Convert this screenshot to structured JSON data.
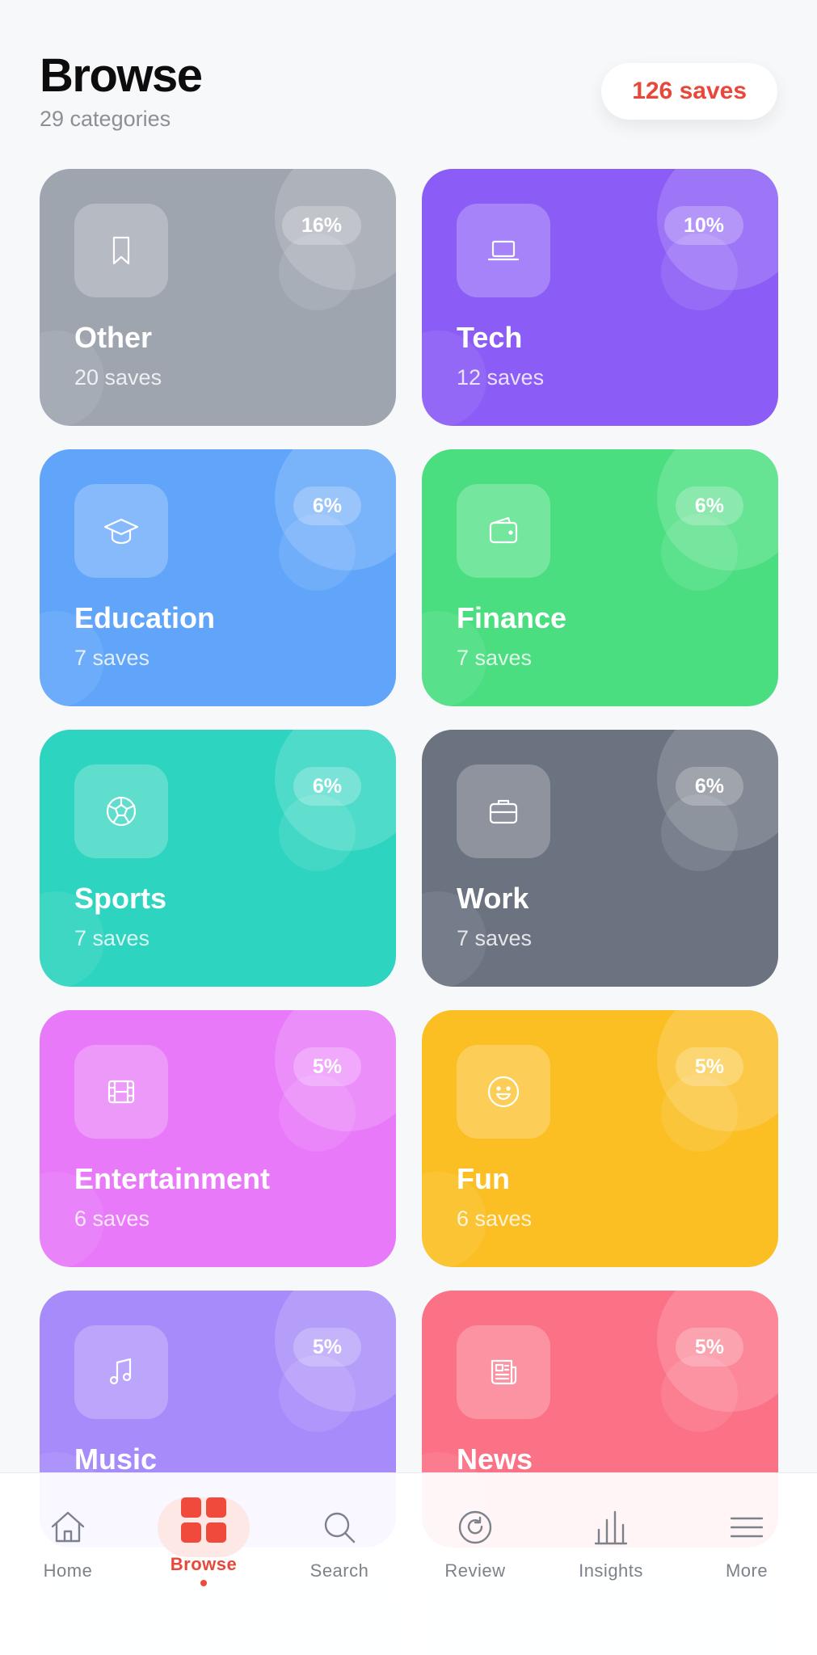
{
  "header": {
    "title": "Browse",
    "subtitle": "29 categories",
    "saves_pill": "126 saves"
  },
  "categories": [
    {
      "name": "Other",
      "count": "20 saves",
      "percent": "16%",
      "icon": "bookmark-icon",
      "color": "#9fa5af"
    },
    {
      "name": "Tech",
      "count": "12 saves",
      "percent": "10%",
      "icon": "laptop-icon",
      "color": "#8b5cf6"
    },
    {
      "name": "Education",
      "count": "7 saves",
      "percent": "6%",
      "icon": "graduation-cap-icon",
      "color": "#60a5fa"
    },
    {
      "name": "Finance",
      "count": "7 saves",
      "percent": "6%",
      "icon": "wallet-icon",
      "color": "#4ade80"
    },
    {
      "name": "Sports",
      "count": "7 saves",
      "percent": "6%",
      "icon": "ball-icon",
      "color": "#2dd4bf"
    },
    {
      "name": "Work",
      "count": "7 saves",
      "percent": "6%",
      "icon": "briefcase-icon",
      "color": "#6b7280"
    },
    {
      "name": "Entertainment",
      "count": "6 saves",
      "percent": "5%",
      "icon": "film-icon",
      "color": "#e879f9"
    },
    {
      "name": "Fun",
      "count": "6 saves",
      "percent": "5%",
      "icon": "smiley-icon",
      "color": "#fbbf24"
    },
    {
      "name": "Music",
      "count": "",
      "percent": "5%",
      "icon": "music-note-icon",
      "color": "#a78bfa"
    },
    {
      "name": "News",
      "count": "",
      "percent": "5%",
      "icon": "newspaper-icon",
      "color": "#fb7185"
    }
  ],
  "tabbar": {
    "tabs": [
      {
        "label": "Home",
        "icon": "home-icon"
      },
      {
        "label": "Browse",
        "icon": "grid-icon",
        "active": true
      },
      {
        "label": "Search",
        "icon": "search-icon"
      },
      {
        "label": "Review",
        "icon": "refresh-icon"
      },
      {
        "label": "Insights",
        "icon": "bar-chart-icon"
      },
      {
        "label": "More",
        "icon": "menu-icon"
      }
    ],
    "accent_color": "#ef4a3c"
  }
}
